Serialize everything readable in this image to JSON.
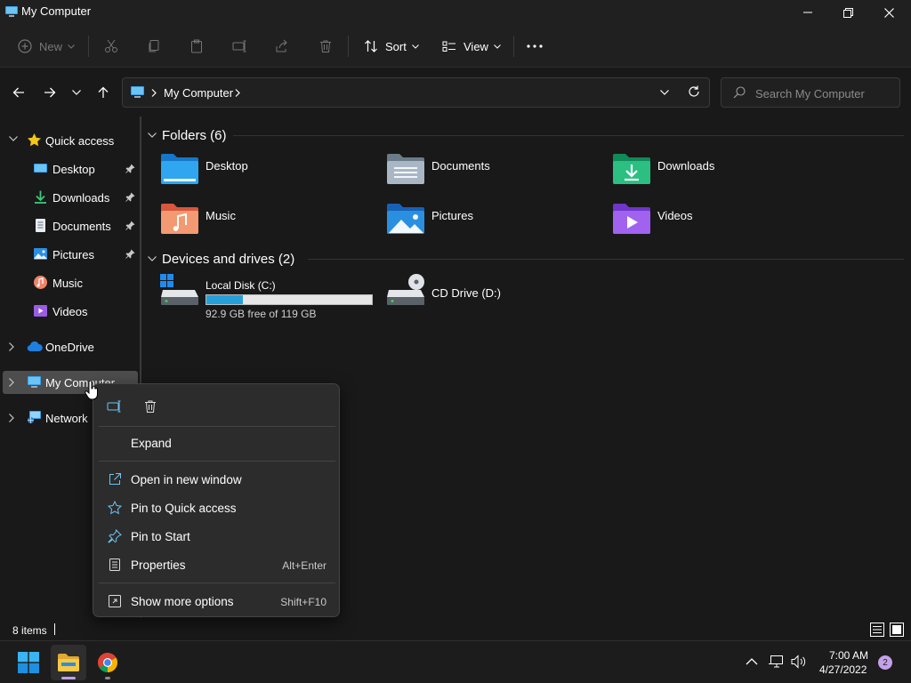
{
  "window": {
    "title": "My Computer"
  },
  "toolbar": {
    "new_label": "New",
    "sort_label": "Sort",
    "view_label": "View"
  },
  "address": {
    "path": "My Computer",
    "search_placeholder": "Search My Computer"
  },
  "sidebar": {
    "quick_access": "Quick access",
    "items": [
      {
        "label": "Desktop",
        "icon": "desktop-icon",
        "pinned": true
      },
      {
        "label": "Downloads",
        "icon": "downloads-icon",
        "pinned": true
      },
      {
        "label": "Documents",
        "icon": "documents-icon",
        "pinned": true
      },
      {
        "label": "Pictures",
        "icon": "pictures-icon",
        "pinned": true
      },
      {
        "label": "Music",
        "icon": "music-icon",
        "pinned": false
      },
      {
        "label": "Videos",
        "icon": "videos-icon",
        "pinned": false
      }
    ],
    "onedrive": "OneDrive",
    "my_computer": "My Computer",
    "network": "Network"
  },
  "main": {
    "folders_header": "Folders (6)",
    "folders": [
      {
        "name": "Desktop",
        "icon": "desktop-folder-icon"
      },
      {
        "name": "Documents",
        "icon": "documents-folder-icon"
      },
      {
        "name": "Downloads",
        "icon": "downloads-folder-icon"
      },
      {
        "name": "Music",
        "icon": "music-folder-icon"
      },
      {
        "name": "Pictures",
        "icon": "pictures-folder-icon"
      },
      {
        "name": "Videos",
        "icon": "videos-folder-icon"
      }
    ],
    "drives_header": "Devices and drives (2)",
    "drives": [
      {
        "name": "Local Disk (C:)",
        "free_text": "92.9 GB free of 119 GB",
        "used_fraction": 0.22
      },
      {
        "name": "CD Drive (D:)"
      }
    ]
  },
  "context_menu": {
    "items": [
      {
        "label": "Expand",
        "shortcut": ""
      },
      {
        "label": "Open in new window",
        "shortcut": ""
      },
      {
        "label": "Pin to Quick access",
        "shortcut": ""
      },
      {
        "label": "Pin to Start",
        "shortcut": ""
      },
      {
        "label": "Properties",
        "shortcut": "Alt+Enter"
      },
      {
        "label": "Show more options",
        "shortcut": "Shift+F10"
      }
    ]
  },
  "status": {
    "item_count": "8 items"
  },
  "taskbar": {
    "time": "7:00 AM",
    "date": "4/27/2022",
    "notification_count": "2"
  },
  "colors": {
    "accent": "#26a0da",
    "folder_yellow": "#f2c14e",
    "star": "#f5c518"
  }
}
